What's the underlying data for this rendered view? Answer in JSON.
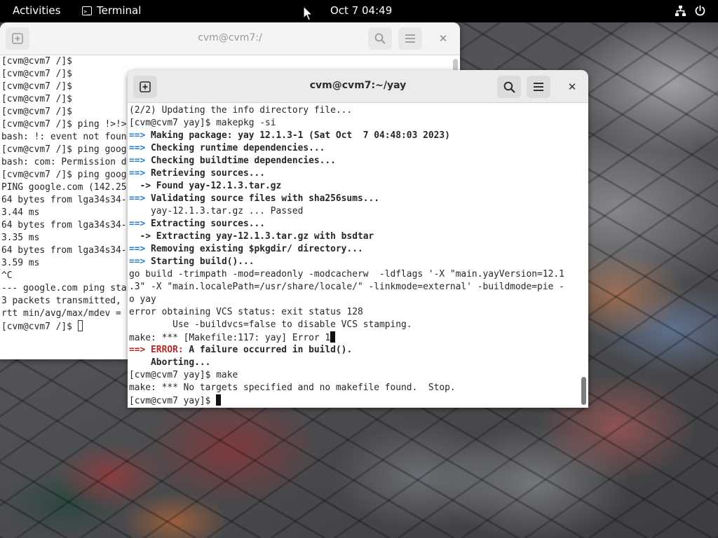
{
  "topbar": {
    "activities": "Activities",
    "app_name": "Terminal",
    "clock": "Oct 7  04:49"
  },
  "back_window": {
    "title": "cvm@cvm7:/",
    "lines": [
      "[cvm@cvm7 /]$",
      "[cvm@cvm7 /]$",
      "[cvm@cvm7 /]$",
      "[cvm@cvm7 /]$",
      "[cvm@cvm7 /]$",
      "[cvm@cvm7 /]$ ping !>!>",
      "bash: !: event not foun",
      "[cvm@cvm7 /]$ ping goog",
      "bash: com: Permission d",
      "[cvm@cvm7 /]$ ping goog",
      "PING google.com (142.25",
      "64 bytes from lga34s34-",
      "3.44 ms",
      "64 bytes from lga34s34-",
      "3.35 ms",
      "64 bytes from lga34s34-",
      "3.59 ms",
      "^C",
      "--- google.com ping sta",
      "3 packets transmitted,",
      "rtt min/avg/max/mdev =",
      "[cvm@cvm7 /]$ "
    ]
  },
  "front_window": {
    "title": "cvm@cvm7:~/yay",
    "lines": [
      {
        "segs": [
          {
            "t": "(2/2) Updating the info directory file...",
            "c": ""
          }
        ]
      },
      {
        "segs": [
          {
            "t": "[cvm@cvm7 yay]$ makepkg -si",
            "c": ""
          }
        ]
      },
      {
        "segs": [
          {
            "t": "==> ",
            "c": "arrow"
          },
          {
            "t": "Making package: yay 12.1.3-1 (Sat Oct  7 04:48:03 2023)",
            "c": "bold"
          }
        ]
      },
      {
        "segs": [
          {
            "t": "==> ",
            "c": "arrow"
          },
          {
            "t": "Checking runtime dependencies...",
            "c": "bold"
          }
        ]
      },
      {
        "segs": [
          {
            "t": "==> ",
            "c": "arrow"
          },
          {
            "t": "Checking buildtime dependencies...",
            "c": "bold"
          }
        ]
      },
      {
        "segs": [
          {
            "t": "==> ",
            "c": "arrow"
          },
          {
            "t": "Retrieving sources...",
            "c": "bold"
          }
        ]
      },
      {
        "segs": [
          {
            "t": "  -> Found yay-12.1.3.tar.gz",
            "c": "bold"
          }
        ]
      },
      {
        "segs": [
          {
            "t": "==> ",
            "c": "arrow"
          },
          {
            "t": "Validating source files with sha256sums...",
            "c": "bold"
          }
        ]
      },
      {
        "segs": [
          {
            "t": "    yay-12.1.3.tar.gz ... Passed",
            "c": ""
          }
        ]
      },
      {
        "segs": [
          {
            "t": "==> ",
            "c": "arrow"
          },
          {
            "t": "Extracting sources...",
            "c": "bold"
          }
        ]
      },
      {
        "segs": [
          {
            "t": "  -> Extracting yay-12.1.3.tar.gz with bsdtar",
            "c": "bold"
          }
        ]
      },
      {
        "segs": [
          {
            "t": "==> ",
            "c": "arrow"
          },
          {
            "t": "Removing existing $pkgdir/ directory...",
            "c": "bold"
          }
        ]
      },
      {
        "segs": [
          {
            "t": "==> ",
            "c": "arrow"
          },
          {
            "t": "Starting build()...",
            "c": "bold"
          }
        ]
      },
      {
        "segs": [
          {
            "t": "go build -trimpath -mod=readonly -modcacherw  -ldflags '-X \"main.yayVersion=12.1",
            "c": ""
          }
        ]
      },
      {
        "segs": [
          {
            "t": ".3\" -X \"main.localePath=/usr/share/locale/\" -linkmode=external' -buildmode=pie -",
            "c": ""
          }
        ]
      },
      {
        "segs": [
          {
            "t": "o yay",
            "c": ""
          }
        ]
      },
      {
        "segs": [
          {
            "t": "error obtaining VCS status: exit status 128",
            "c": ""
          }
        ]
      },
      {
        "segs": [
          {
            "t": "        Use -buildvcs=false to disable VCS stamping.",
            "c": ""
          }
        ]
      },
      {
        "segs": [
          {
            "t": "make: *** [Makefile:117: yay] Error 1",
            "c": ""
          }
        ],
        "cursor": true
      },
      {
        "segs": [
          {
            "t": "==> ",
            "c": "err"
          },
          {
            "t": "ERROR: ",
            "c": "err"
          },
          {
            "t": "A failure occurred in build().",
            "c": "bold"
          }
        ]
      },
      {
        "segs": [
          {
            "t": "    Aborting...",
            "c": "bold"
          }
        ]
      },
      {
        "segs": [
          {
            "t": "[cvm@cvm7 yay]$ make",
            "c": ""
          }
        ]
      },
      {
        "segs": [
          {
            "t": "make: *** No targets specified and no makefile found.  Stop.",
            "c": ""
          }
        ]
      },
      {
        "segs": [
          {
            "t": "[cvm@cvm7 yay]$ ",
            "c": ""
          }
        ],
        "cursor": true
      }
    ]
  },
  "colors": {
    "arrow": "#2a7fd4",
    "error": "#b82828",
    "topbar": "#000000",
    "headerbar": "#ebebeb"
  },
  "icons": {
    "new_tab": "new-tab-icon",
    "search": "search-icon",
    "menu": "hamburger-menu-icon",
    "close": "close-icon",
    "network": "network-icon",
    "power": "power-icon"
  }
}
